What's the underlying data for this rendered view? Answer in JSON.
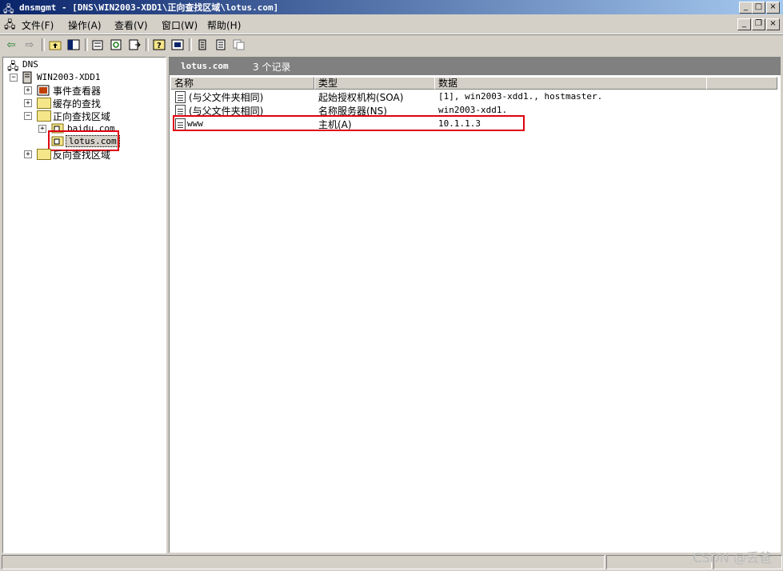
{
  "window": {
    "title": "dnsmgmt - [DNS\\WIN2003-XDD1\\正向查找区域\\lotus.com]",
    "buttons": {
      "minimize": "_",
      "maximize": "□",
      "close": "×"
    },
    "child_buttons": {
      "minimize": "_",
      "restore": "❐",
      "close": "×"
    }
  },
  "menu": {
    "items": [
      "文件(F)",
      "操作(A)",
      "查看(V)",
      "窗口(W)",
      "帮助(H)"
    ]
  },
  "toolbar": {
    "icons": [
      "back-icon",
      "forward-icon",
      "up-folder-icon",
      "show-hide-tree-icon",
      "properties-icon",
      "refresh-icon",
      "export-list-icon",
      "help-icon",
      "console-icon",
      "new-record-icon",
      "new-record-2-icon",
      "copy-icon"
    ]
  },
  "tree": {
    "root": "DNS",
    "server": "WIN2003-XDD1",
    "event_viewer": "事件查看器",
    "cached_lookups": "缓存的查找",
    "forward_zones": "正向查找区域",
    "zone_baidu": "baidu.com",
    "zone_lotus": "lotus.com",
    "reverse_zones": "反向查找区域"
  },
  "details": {
    "zone_name": "lotus.com",
    "record_count": "3 个记录",
    "columns": [
      "名称",
      "类型",
      "数据"
    ],
    "rows": [
      {
        "name": "(与父文件夹相同)",
        "type": "起始授权机构(SOA)",
        "data": "[1], win2003-xdd1., hostmaster."
      },
      {
        "name": "(与父文件夹相同)",
        "type": "名称服务器(NS)",
        "data": "win2003-xdd1."
      },
      {
        "name": "www",
        "type": "主机(A)",
        "data": "10.1.1.3"
      }
    ]
  },
  "watermark": "CSDN @丢爸",
  "colors": {
    "titlebar_start": "#0a246a",
    "titlebar_end": "#a6caf0",
    "highlight_box": "#e0000f",
    "chrome": "#d4d0c8"
  }
}
